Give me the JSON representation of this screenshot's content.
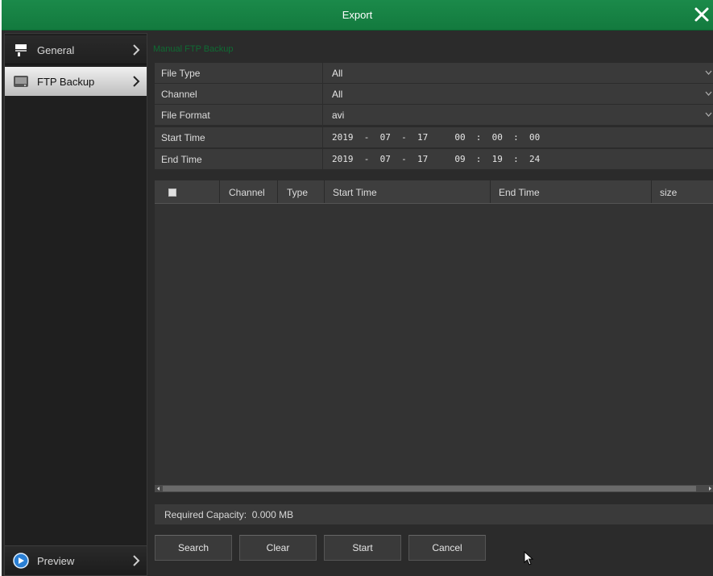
{
  "window": {
    "title": "Export"
  },
  "sidebar": {
    "items": [
      {
        "label": "General",
        "icon": "server-icon"
      },
      {
        "label": "FTP Backup",
        "icon": "hard-drive-icon",
        "active": true
      }
    ],
    "bottom": {
      "label": "Preview",
      "icon": "preview-icon"
    }
  },
  "section_title": "Manual FTP Backup",
  "form": {
    "file_type": {
      "label": "File Type",
      "value": "All"
    },
    "channel": {
      "label": "Channel",
      "value": "All"
    },
    "file_format": {
      "label": "File Format",
      "value": "avi"
    },
    "start_time": {
      "label": "Start Time",
      "value": "2019  -  07  -  17     00  :  00  :  00"
    },
    "end_time": {
      "label": "End Time",
      "value": "2019  -  07  -  17     09  :  19  :  24"
    }
  },
  "table": {
    "columns": [
      "Channel",
      "Type",
      "Start Time",
      "End Time",
      "size"
    ],
    "rows": []
  },
  "capacity": {
    "text": "Required Capacity:  0.000 MB"
  },
  "buttons": {
    "search": "Search",
    "clear": "Clear",
    "start": "Start",
    "cancel": "Cancel"
  },
  "colors": {
    "title_bar": "#1b8a4a",
    "section_title": "#0f6b33",
    "background": "#2b2b2b"
  }
}
